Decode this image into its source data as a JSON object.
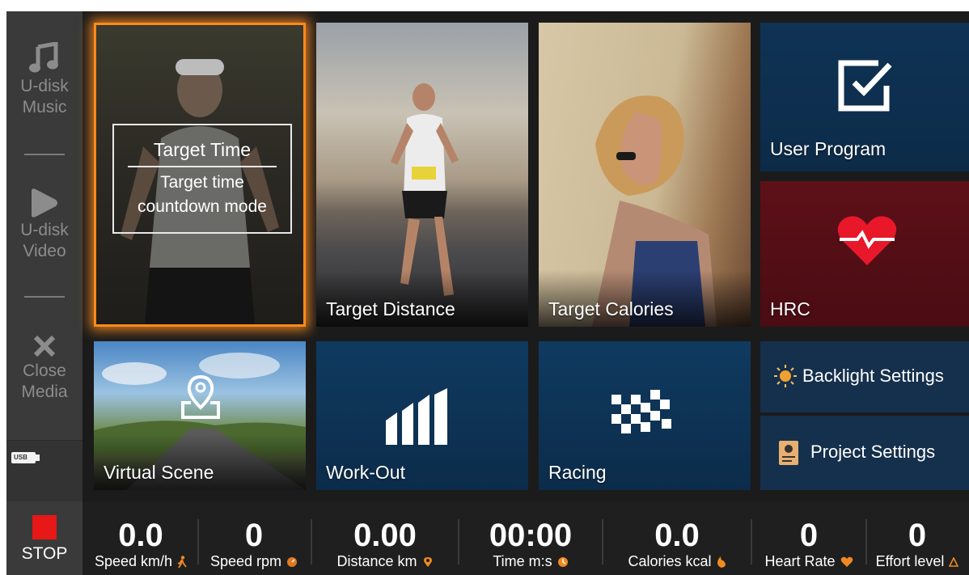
{
  "sidebar": {
    "items": [
      {
        "label_1": "U-disk",
        "label_2": "Music",
        "icon": "music-note-icon"
      },
      {
        "label_1": "U-disk",
        "label_2": "Video",
        "icon": "play-icon"
      },
      {
        "label_1": "Close",
        "label_2": "Media",
        "icon": "close-icon"
      }
    ],
    "usb_label": "USB"
  },
  "tiles": {
    "target_time": {
      "title": "Target Time",
      "desc_1": "Target time",
      "desc_2": "countdown mode",
      "selected": true
    },
    "target_distance": {
      "label": "Target Distance"
    },
    "target_calories": {
      "label": "Target Calories"
    },
    "user_program": {
      "label": "User Program",
      "icon": "checkbox-icon"
    },
    "hrc": {
      "label": "HRC",
      "icon": "heart-pulse-icon"
    },
    "virtual_scene": {
      "label": "Virtual Scene",
      "icon": "map-pin-icon"
    },
    "work_out": {
      "label": "Work-Out",
      "icon": "bar-levels-icon"
    },
    "racing": {
      "label": "Racing",
      "icon": "checkered-flag-icon"
    },
    "backlight_settings": {
      "label": "Backlight Settings",
      "icon": "sun-icon"
    },
    "project_settings": {
      "label": "Project  Settings",
      "icon": "settings-document-icon"
    }
  },
  "bottom_bar": {
    "stop_label": "STOP",
    "stats": [
      {
        "value": "0.0",
        "label": "Speed km/h",
        "icon": "runner-icon"
      },
      {
        "value": "0",
        "label": "Speed rpm",
        "icon": "gauge-icon"
      },
      {
        "value": "0.00",
        "label": "Distance km",
        "icon": "pin-icon"
      },
      {
        "value": "00:00",
        "label": "Time m:s",
        "icon": "clock-icon"
      },
      {
        "value": "0.0",
        "label": "Calories kcal",
        "icon": "flame-icon"
      },
      {
        "value": "0",
        "label": "Heart Rate",
        "icon": "heart-icon"
      },
      {
        "value": "0",
        "label": "Effort level",
        "icon": "triangle-icon"
      }
    ]
  },
  "colors": {
    "accent_orange": "#ff8a1a",
    "stop_red": "#e81818",
    "tile_blue": "#0f3a60",
    "hrc_red": "#5e1018",
    "heart_red": "#e8182a"
  }
}
